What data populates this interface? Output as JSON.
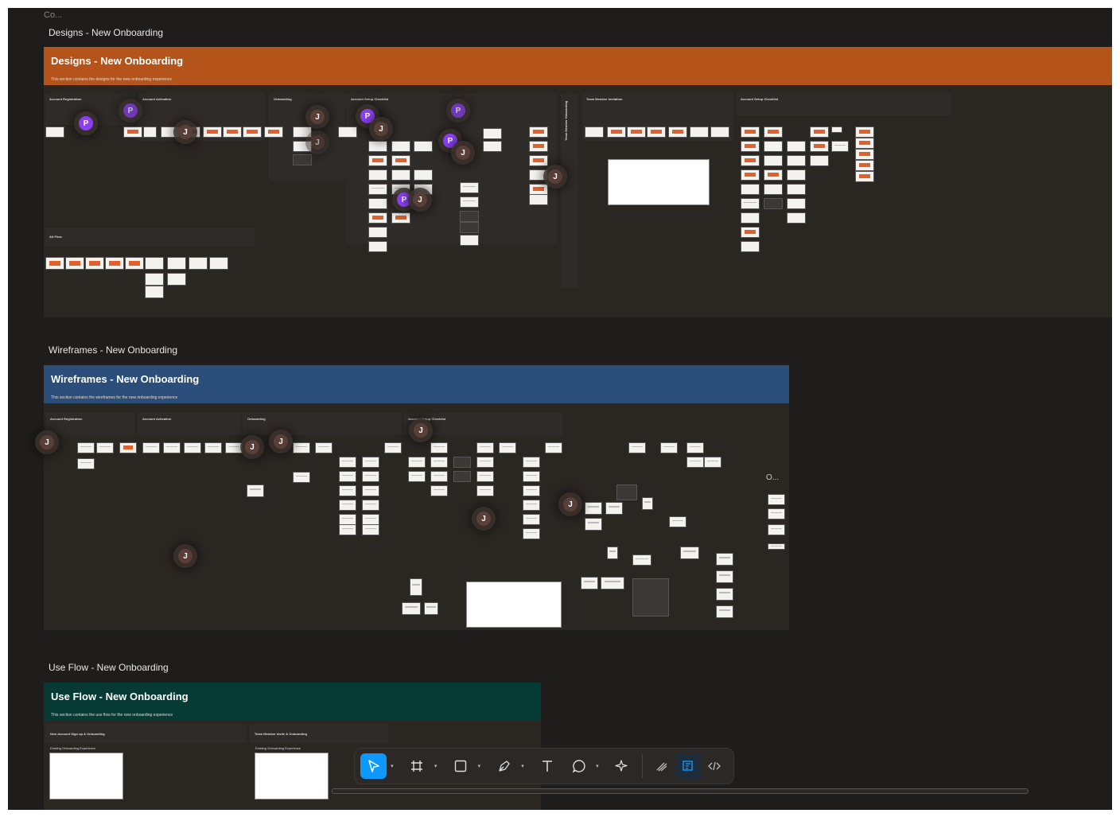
{
  "canvas": {
    "truncated_label": "Co..."
  },
  "sections": [
    {
      "id": "designs",
      "tab": "Designs - New Onboarding",
      "title": "Designs - New Onboarding",
      "desc": "This section contains the designs for the new onboarding experience",
      "color": "#b4541a",
      "groups": [
        "Account Registration",
        "Account Activation",
        "Onboarding",
        "Account Setup Checklist",
        "Team Member Onboarding",
        "Team Member Invitation",
        "Account Setup Checklist",
        "Alt Flow"
      ]
    },
    {
      "id": "wireframes",
      "tab": "Wireframes - New Onboarding",
      "title": "Wireframes - New Onboarding",
      "desc": "This section contains the wireframes for the new onboarding experience",
      "color": "#2a4d7a",
      "groups": [
        "Account Registration",
        "Account Activation",
        "Onboarding",
        "Account Setup Checklist"
      ],
      "misc_label": "O..."
    },
    {
      "id": "useflow",
      "tab": "Use Flow - New Onboarding",
      "title": "Use Flow - New Onboarding",
      "desc": "This section contains the use flow for the new onboarding experience",
      "color": "#063a34",
      "groups": [
        "New Account Sign up & Onboarding",
        "Team Member Invite & Onboarding"
      ],
      "subs": [
        "Existing Onboarding Experience",
        "Existing Onboarding Experience"
      ]
    }
  ],
  "avatars": {
    "j": "J",
    "p": "P"
  },
  "toolbar": {
    "tools": [
      {
        "name": "move-tool",
        "icon": "cursor-icon",
        "active": true,
        "dropdown": true
      },
      {
        "name": "frame-tool",
        "icon": "frame-icon",
        "active": false,
        "dropdown": true
      },
      {
        "name": "shape-tool",
        "icon": "rectangle-icon",
        "active": false,
        "dropdown": true
      },
      {
        "name": "pen-tool",
        "icon": "pen-icon",
        "active": false,
        "dropdown": true
      },
      {
        "name": "text-tool",
        "icon": "text-icon",
        "active": false,
        "dropdown": false
      },
      {
        "name": "comment-tool",
        "icon": "comment-icon",
        "active": false,
        "dropdown": true
      },
      {
        "name": "actions-tool",
        "icon": "sparkle-icon",
        "active": false,
        "dropdown": false
      }
    ],
    "modes": [
      {
        "name": "draw-mode",
        "icon": "draw-icon"
      },
      {
        "name": "design-mode",
        "icon": "design-icon",
        "active": true
      },
      {
        "name": "dev-mode",
        "icon": "code-icon"
      }
    ]
  },
  "colors": {
    "canvas": "#1f1d1b",
    "accent": "#0d99ff",
    "avatar_p": "#8a3ff0",
    "avatar_j": "#5a3f38"
  }
}
